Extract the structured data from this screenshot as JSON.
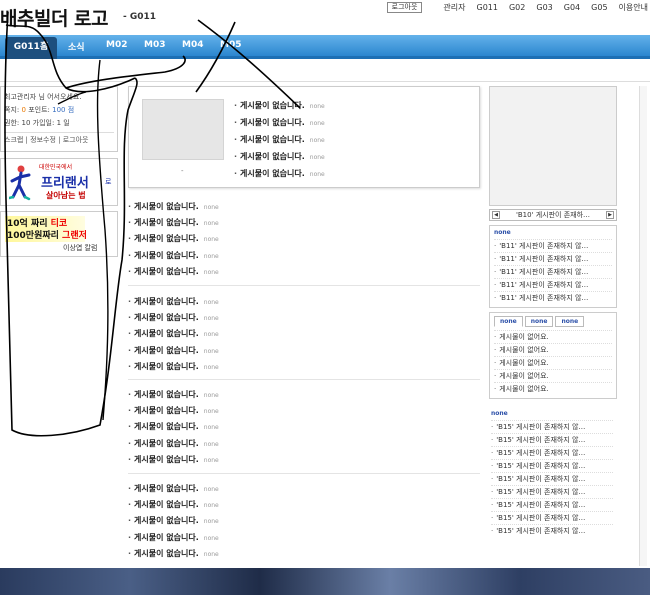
{
  "header": {
    "logo": "배추빌더 로고",
    "site_id": "- G011",
    "logout": "로그아웃",
    "links": [
      "관리자",
      "G011",
      "G02",
      "G03",
      "G04",
      "G05",
      "이용안내"
    ]
  },
  "nav": {
    "tabs": [
      "G011홈",
      "소식",
      "M02",
      "M03",
      "M04",
      "M05"
    ]
  },
  "login": {
    "user": "최고관리자",
    "greet": "님 어서오세요.",
    "points_label": "쪽지:",
    "points_val": "0",
    "point_label": "포인트:",
    "point_val": "100 점",
    "level_label": "권한:",
    "level_val": "10",
    "join_label": "가입일:",
    "join_val": "1 일",
    "links": "스크랩 | 정보수정 | 로그아웃"
  },
  "banner1": {
    "small": "대한민국에서",
    "big": "프리랜서",
    "ro": "로",
    "sub": "살아남는 법"
  },
  "banner2": {
    "l1a": "10억 짜리 ",
    "l1b": "티코",
    "l2a": "100만원짜리 ",
    "l2b": "그랜저",
    "l3": "이상엽 칼럼"
  },
  "featured": {
    "caption": "-",
    "rows": [
      "게시물이 없습니다.",
      "게시물이 없습니다.",
      "게시물이 없습니다.",
      "게시물이 없습니다.",
      "게시물이 없습니다."
    ],
    "none": "none"
  },
  "groups": [
    {
      "rows": [
        "게시물이 없습니다.",
        "게시물이 없습니다.",
        "게시물이 없습니다.",
        "게시물이 없습니다.",
        "게시물이 없습니다."
      ]
    },
    {
      "rows": [
        "게시물이 없습니다.",
        "게시물이 없습니다.",
        "게시물이 없습니다.",
        "게시물이 없습니다.",
        "게시물이 없습니다."
      ]
    },
    {
      "rows": [
        "게시물이 없습니다.",
        "게시물이 없습니다.",
        "게시물이 없습니다.",
        "게시물이 없습니다.",
        "게시물이 없습니다."
      ]
    },
    {
      "rows": [
        "게시물이 없습니다.",
        "게시물이 없습니다.",
        "게시물이 없습니다.",
        "게시물이 없습니다.",
        "게시물이 없습니다."
      ]
    }
  ],
  "right": {
    "slider_label": "'B10' 게시판이 존재하…",
    "box1_head": "none",
    "box1_rows": [
      "'B11' 게시판이 존재하지 않…",
      "'B11' 게시판이 존재하지 않…",
      "'B11' 게시판이 존재하지 않…",
      "'B11' 게시판이 존재하지 않…",
      "'B11' 게시판이 존재하지 않…"
    ],
    "tabs": [
      "none",
      "none",
      "none"
    ],
    "box2_rows": [
      "게시물이 없어요.",
      "게시물이 없어요.",
      "게시물이 없어요.",
      "게시물이 없어요.",
      "게시물이 없어요."
    ],
    "box3_head": "none",
    "box3_rows": [
      "'B15' 게시판이 존재하지 않…",
      "'B15' 게시판이 존재하지 않…",
      "'B15' 게시판이 존재하지 않…",
      "'B15' 게시판이 존재하지 않…",
      "'B15' 게시판이 존재하지 않…",
      "'B15' 게시판이 존재하지 않…",
      "'B15' 게시판이 존재하지 않…",
      "'B15' 게시판이 존재하지 않…",
      "'B15' 게시판이 존재하지 않…",
      "'B15' 게시판이 존재하지 않…"
    ]
  }
}
